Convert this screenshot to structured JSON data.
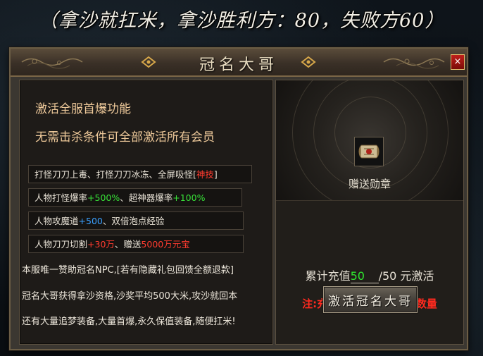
{
  "banner": {
    "text": "（拿沙就扛米，拿沙胜利方：80，失败方60）"
  },
  "window": {
    "title": "冠名大哥",
    "close_label": "×"
  },
  "left": {
    "headline1": "激活全服首爆功能",
    "headline2": "无需击杀条件可全部激活所有会员",
    "tags": [
      {
        "pre": "打怪刀刀上毒、打怪刀刀冰冻、全屏吸怪",
        "open": "[",
        "hl": "神技",
        "close": "]"
      },
      {
        "pre": "人物打怪爆率",
        "v1": "+500%",
        "mid": "、超神器爆率",
        "v2": "+100%"
      },
      {
        "pre": "人物攻魔道",
        "v1": "+500",
        "mid": "、双倍泡点经验"
      },
      {
        "pre": "人物刀刀切割",
        "v1": "+30万",
        "mid": "、赠送",
        "v2": "5000万元宝"
      }
    ],
    "desc1": "本服唯一赞助冠名NPC,[若有隐藏礼包回馈全额退款]",
    "desc2": "冠名大哥获得拿沙资格,沙奖平均500大米,攻沙就回本",
    "desc3": "还有大量追梦装备,大量首爆,永久保值装备,随便扛米!"
  },
  "right": {
    "medal_icon": "medal-badge-icon",
    "medal_label": "赠送勋章",
    "charge_prefix": "累计充值",
    "charge_value": "50",
    "charge_suffix": "/50 元激活",
    "notice": "注:充值九龍币,才有充值数量",
    "activate_label": "激活冠名大哥"
  },
  "colors": {
    "accent_red": "#ff2a1f",
    "accent_green": "#2fe62f",
    "accent_blue": "#3aa0ff",
    "gold_text": "#eec99a"
  }
}
